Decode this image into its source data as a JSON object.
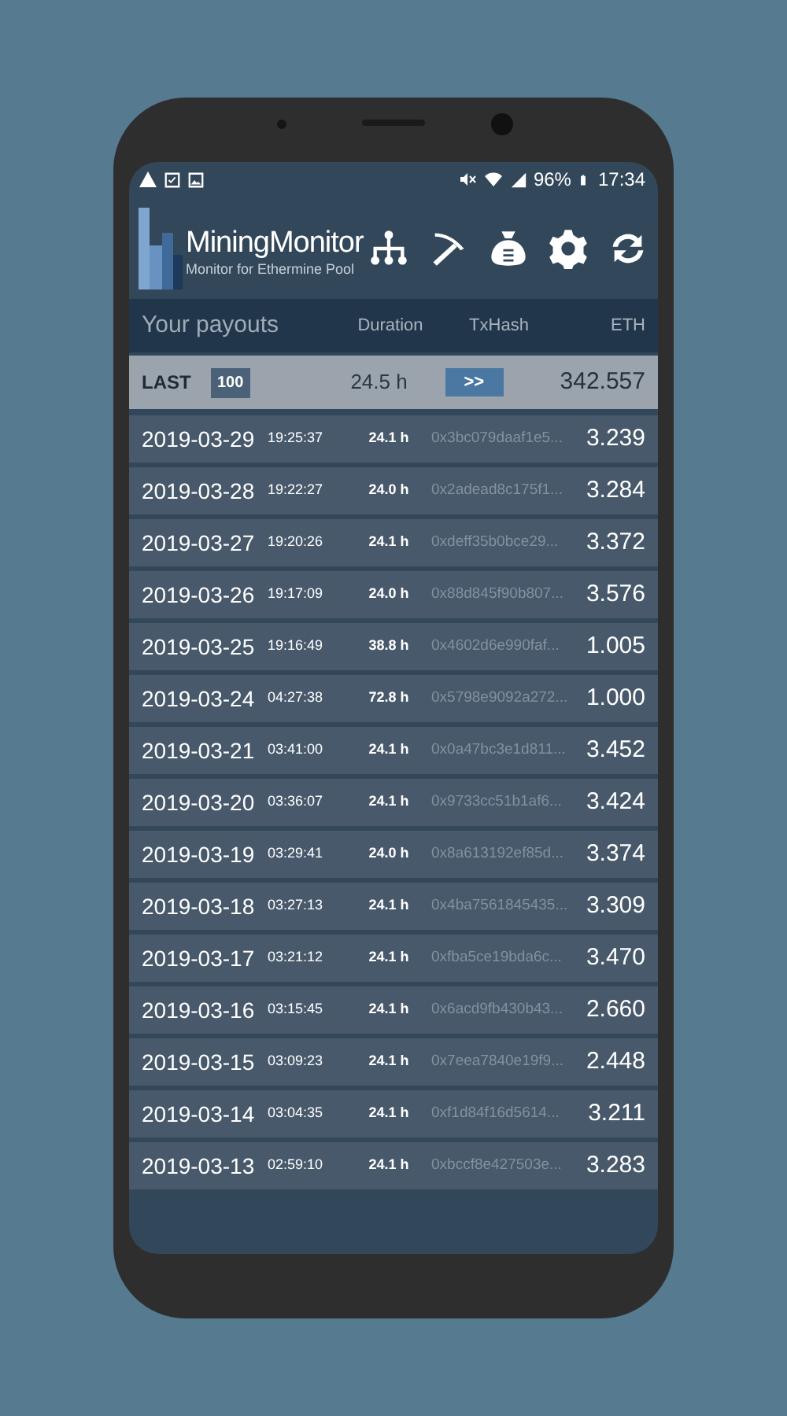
{
  "status_bar": {
    "battery": "96%",
    "time": "17:34"
  },
  "header": {
    "title": "MiningMonitor",
    "subtitle": "Monitor for Ethermine Pool"
  },
  "columns": [
    "Your payouts",
    "Duration",
    "TxHash",
    "ETH"
  ],
  "summary": {
    "label": "LAST",
    "count": "100",
    "duration": "24.5 h",
    "button": ">>",
    "total": "342.557"
  },
  "payouts": [
    {
      "date": "2019-03-29",
      "time": "19:25:37",
      "duration": "24.1 h",
      "txhash": "0x3bc079daaf1e5...",
      "eth": "3.239"
    },
    {
      "date": "2019-03-28",
      "time": "19:22:27",
      "duration": "24.0 h",
      "txhash": "0x2adead8c175f1...",
      "eth": "3.284"
    },
    {
      "date": "2019-03-27",
      "time": "19:20:26",
      "duration": "24.1 h",
      "txhash": "0xdeff35b0bce29...",
      "eth": "3.372"
    },
    {
      "date": "2019-03-26",
      "time": "19:17:09",
      "duration": "24.0 h",
      "txhash": "0x88d845f90b807...",
      "eth": "3.576"
    },
    {
      "date": "2019-03-25",
      "time": "19:16:49",
      "duration": "38.8 h",
      "txhash": "0x4602d6e990faf...",
      "eth": "1.005"
    },
    {
      "date": "2019-03-24",
      "time": "04:27:38",
      "duration": "72.8 h",
      "txhash": "0x5798e9092a272...",
      "eth": "1.000"
    },
    {
      "date": "2019-03-21",
      "time": "03:41:00",
      "duration": "24.1 h",
      "txhash": "0x0a47bc3e1d811...",
      "eth": "3.452"
    },
    {
      "date": "2019-03-20",
      "time": "03:36:07",
      "duration": "24.1 h",
      "txhash": "0x9733cc51b1af6...",
      "eth": "3.424"
    },
    {
      "date": "2019-03-19",
      "time": "03:29:41",
      "duration": "24.0 h",
      "txhash": "0x8a613192ef85d...",
      "eth": "3.374"
    },
    {
      "date": "2019-03-18",
      "time": "03:27:13",
      "duration": "24.1 h",
      "txhash": "0x4ba7561845435...",
      "eth": "3.309"
    },
    {
      "date": "2019-03-17",
      "time": "03:21:12",
      "duration": "24.1 h",
      "txhash": "0xfba5ce19bda6c...",
      "eth": "3.470"
    },
    {
      "date": "2019-03-16",
      "time": "03:15:45",
      "duration": "24.1 h",
      "txhash": "0x6acd9fb430b43...",
      "eth": "2.660"
    },
    {
      "date": "2019-03-15",
      "time": "03:09:23",
      "duration": "24.1 h",
      "txhash": "0x7eea7840e19f9...",
      "eth": "2.448"
    },
    {
      "date": "2019-03-14",
      "time": "03:04:35",
      "duration": "24.1 h",
      "txhash": "0xf1d84f16d5614...",
      "eth": "3.211"
    },
    {
      "date": "2019-03-13",
      "time": "02:59:10",
      "duration": "24.1 h",
      "txhash": "0xbccf8e427503e...",
      "eth": "3.283"
    }
  ]
}
